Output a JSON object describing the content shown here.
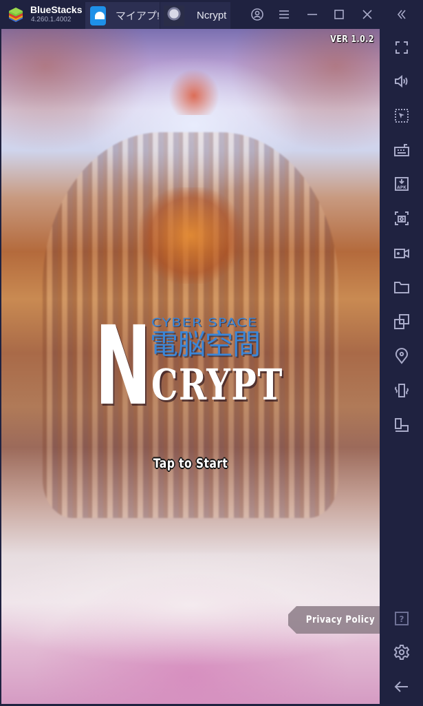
{
  "window": {
    "app_name": "BlueStacks",
    "app_version": "4.260.1.4002",
    "tabs": [
      {
        "label": "マイアプ!",
        "icon": "home-icon",
        "active": false
      },
      {
        "label": "Ncrypt",
        "icon": "game-avatar-icon",
        "active": true
      }
    ],
    "controls": [
      {
        "name": "account",
        "icon": "account-icon"
      },
      {
        "name": "menu",
        "icon": "menu-icon"
      },
      {
        "name": "minimize",
        "icon": "minimize-icon"
      },
      {
        "name": "maximize",
        "icon": "maximize-icon"
      },
      {
        "name": "close",
        "icon": "close-icon"
      },
      {
        "name": "collapse-sidebar",
        "icon": "double-chevron-left-icon"
      }
    ]
  },
  "game": {
    "version": "VER 1.0.2",
    "logo": {
      "subtitle_en": "CYBER SPACE",
      "subtitle_jp": "電脳空間",
      "n_letter": "N",
      "title_rest": "CRYPT"
    },
    "tap_to_start": "Tap to Start",
    "privacy_policy": "Privacy Policy"
  },
  "sidebar": {
    "items": [
      {
        "name": "fullscreen",
        "icon": "fullscreen-icon"
      },
      {
        "name": "volume",
        "icon": "volume-icon"
      },
      {
        "name": "pointer-select",
        "icon": "pointer-select-icon"
      },
      {
        "name": "keyboard-controls",
        "icon": "keyboard-icon"
      },
      {
        "name": "install-apk",
        "icon": "apk-install-icon"
      },
      {
        "name": "screenshot",
        "icon": "screenshot-icon"
      },
      {
        "name": "record-video",
        "icon": "video-record-icon"
      },
      {
        "name": "media-folder",
        "icon": "folder-icon"
      },
      {
        "name": "multi-instance",
        "icon": "multi-instance-icon"
      },
      {
        "name": "location",
        "icon": "location-pin-icon"
      },
      {
        "name": "shake",
        "icon": "shake-icon"
      },
      {
        "name": "rotate",
        "icon": "rotate-icon"
      },
      {
        "name": "help",
        "icon": "help-icon"
      },
      {
        "name": "settings",
        "icon": "gear-icon"
      },
      {
        "name": "back",
        "icon": "back-arrow-icon"
      }
    ]
  },
  "colors": {
    "chrome_bg": "#1f2240",
    "icon_color": "#a9abc9",
    "logo_blue": "#3a86d8",
    "home_tab_blue": "#1e90e8"
  }
}
